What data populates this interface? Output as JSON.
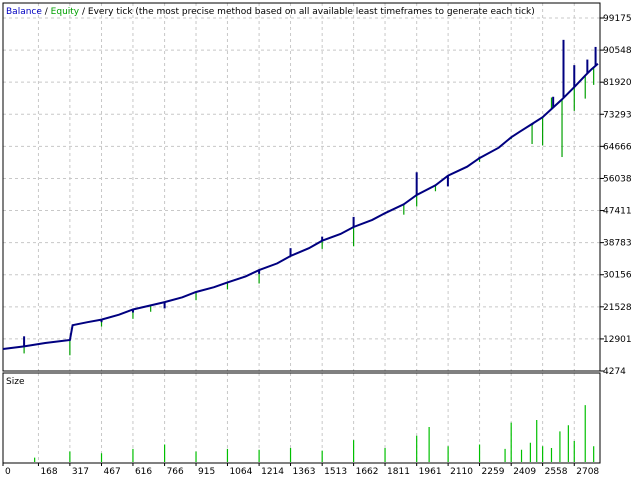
{
  "header": {
    "balance_label": "Balance",
    "sep1": " / ",
    "equity_label": "Equity",
    "sep2": " / ",
    "description": "Every tick (the most precise method based on all available least timeframes to generate each tick)"
  },
  "size_panel": {
    "label": "Size"
  },
  "colors": {
    "balance": "#000080",
    "equity": "#00a000",
    "size_bar": "#00c000",
    "grid": "#c8c8c8",
    "axis": "#000000",
    "background": "#ffffff",
    "balance_label": "#0000c0",
    "equity_label": "#00a000"
  },
  "chart_data": {
    "type": "line",
    "title": "",
    "grid": true,
    "x_ticks": [
      "0",
      "168",
      "317",
      "467",
      "616",
      "766",
      "915",
      "1064",
      "1214",
      "1363",
      "1513",
      "1662",
      "1811",
      "1961",
      "2110",
      "2259",
      "2409",
      "2558",
      "2708"
    ],
    "xlim": [
      0,
      2830
    ],
    "y_ticks": [
      "99175",
      "90548",
      "81920",
      "73293",
      "64666",
      "56038",
      "47411",
      "38783",
      "30156",
      "21528",
      "12901",
      "4274"
    ],
    "ylim": [
      4274,
      99175
    ],
    "series": [
      {
        "name": "Balance",
        "x": [
          0,
          100,
          200,
          317,
          330,
          400,
          467,
          550,
          616,
          700,
          766,
          850,
          915,
          1000,
          1064,
          1150,
          1214,
          1300,
          1363,
          1450,
          1513,
          1600,
          1662,
          1750,
          1811,
          1900,
          1961,
          2050,
          2110,
          2200,
          2259,
          2350,
          2409,
          2450,
          2500,
          2558,
          2600,
          2650,
          2708,
          2760,
          2790,
          2820
        ],
        "values": [
          10200,
          10900,
          11800,
          12600,
          16600,
          17400,
          18100,
          19400,
          20800,
          21900,
          22800,
          24100,
          25500,
          26800,
          28100,
          29700,
          31400,
          33200,
          35200,
          37300,
          39300,
          41100,
          43000,
          44900,
          46700,
          49100,
          51600,
          54200,
          56800,
          59200,
          61500,
          64300,
          67100,
          68600,
          70400,
          72500,
          74700,
          77300,
          80600,
          83700,
          85400,
          86900
        ]
      },
      {
        "name": "Equity",
        "x": [
          100,
          317,
          467,
          616,
          700,
          915,
          1064,
          1214,
          1363,
          1513,
          1662,
          1900,
          1961,
          2050,
          2109,
          2259,
          2409,
          2508,
          2558,
          2600,
          2650,
          2708,
          2760,
          2800
        ],
        "values": [
          9000,
          8500,
          16200,
          18300,
          20200,
          23300,
          26200,
          27800,
          36600,
          37100,
          37800,
          46300,
          48500,
          52600,
          54200,
          60500,
          66600,
          65300,
          64900,
          77800,
          61800,
          74200,
          77500,
          81200
        ]
      }
    ],
    "spikes_up": {
      "x": [
        100,
        467,
        616,
        766,
        1214,
        1363,
        1513,
        1662,
        1961,
        2109,
        2259,
        2509,
        2608,
        2657,
        2708,
        2770,
        2809
      ],
      "values": [
        13600,
        17400,
        20000,
        21100,
        30400,
        37300,
        40400,
        45700,
        57700,
        53900,
        61900,
        70400,
        78000,
        93300,
        86500,
        88000,
        91400
      ]
    },
    "size_series": {
      "name": "Size",
      "x": [
        150,
        317,
        467,
        616,
        766,
        915,
        1064,
        1214,
        1363,
        1513,
        1662,
        1811,
        1961,
        2020,
        2110,
        2259,
        2380,
        2409,
        2458,
        2500,
        2530,
        2558,
        2600,
        2640,
        2680,
        2708,
        2760,
        2800
      ],
      "values": [
        0.5,
        1.2,
        1.0,
        1.5,
        2.0,
        1.2,
        1.5,
        1.4,
        1.6,
        1.3,
        2.5,
        1.6,
        3.0,
        4.0,
        1.8,
        2.0,
        1.5,
        4.5,
        1.4,
        2.2,
        4.8,
        1.8,
        1.6,
        3.5,
        4.2,
        2.4,
        6.5,
        1.8
      ]
    }
  }
}
